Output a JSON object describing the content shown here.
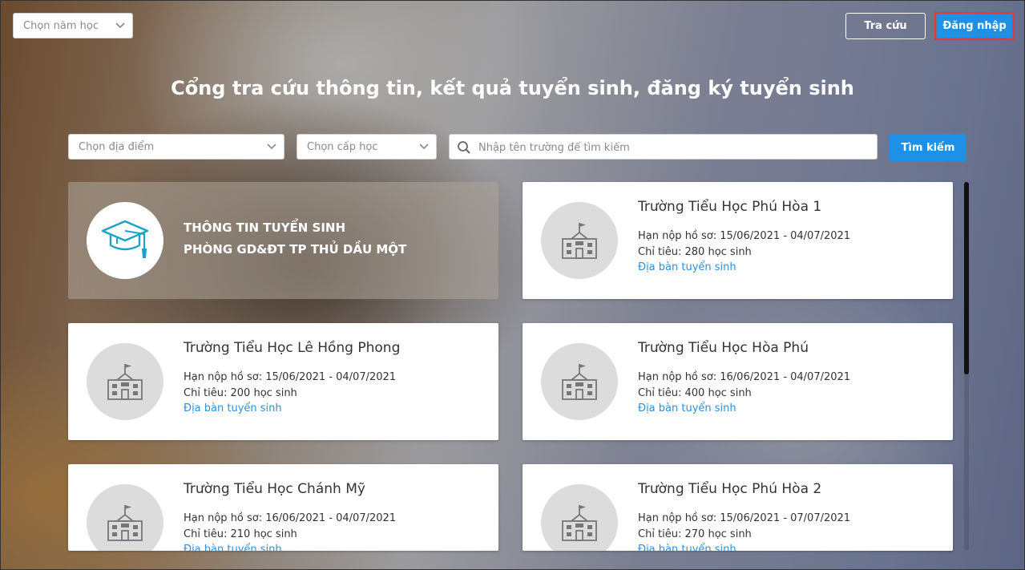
{
  "header": {
    "year_select": "Chọn năm học",
    "lookup_label": "Tra cứu",
    "login_label": "Đăng nhập"
  },
  "title": "Cổng tra cứu thông tin, kết quả tuyển sinh, đăng ký tuyển sinh",
  "filters": {
    "location": "Chọn địa điểm",
    "level": "Chọn cấp học",
    "search_placeholder": "Nhập tên trường để tìm kiếm",
    "search_button": "Tìm kiếm"
  },
  "banner": {
    "line1": "THÔNG TIN TUYỂN SINH",
    "line2": "PHÒNG GD&ĐT TP THỦ DẦU MỘT"
  },
  "schools": [
    {
      "name": "Trường Tiểu Học Phú Hòa 1",
      "deadline": "Hạn nộp hồ sơ: 15/06/2021 - 04/07/2021",
      "quota": "Chỉ tiêu: 280 học sinh",
      "link": "Địa bàn tuyển sinh"
    },
    {
      "name": "Trường Tiểu Học Lê Hồng Phong",
      "deadline": "Hạn nộp hồ sơ: 15/06/2021 - 04/07/2021",
      "quota": "Chỉ tiêu: 200 học sinh",
      "link": "Địa bàn tuyển sinh"
    },
    {
      "name": "Trường Tiểu Học Hòa Phú",
      "deadline": "Hạn nộp hồ sơ: 16/06/2021 - 04/07/2021",
      "quota": "Chỉ tiêu: 400 học sinh",
      "link": "Địa bàn tuyển sinh"
    },
    {
      "name": "Trường Tiểu Học Chánh Mỹ",
      "deadline": "Hạn nộp hồ sơ: 16/06/2021 - 04/07/2021",
      "quota": "Chỉ tiêu: 210 học sinh",
      "link": "Địa bàn tuyển sinh"
    },
    {
      "name": "Trường Tiểu Học Phú Hòa 2",
      "deadline": "Hạn nộp hồ sơ: 15/06/2021 - 07/07/2021",
      "quota": "Chỉ tiêu: 270 học sinh",
      "link": "Địa bàn tuyển sinh"
    }
  ],
  "icons": {
    "chevron": "chevron-down-icon",
    "search": "search-icon",
    "banner": "graduation-cap-icon",
    "school": "school-building-icon"
  },
  "colors": {
    "accent": "#1e90e6",
    "link": "#2f8fd8",
    "highlight": "#e53935"
  }
}
